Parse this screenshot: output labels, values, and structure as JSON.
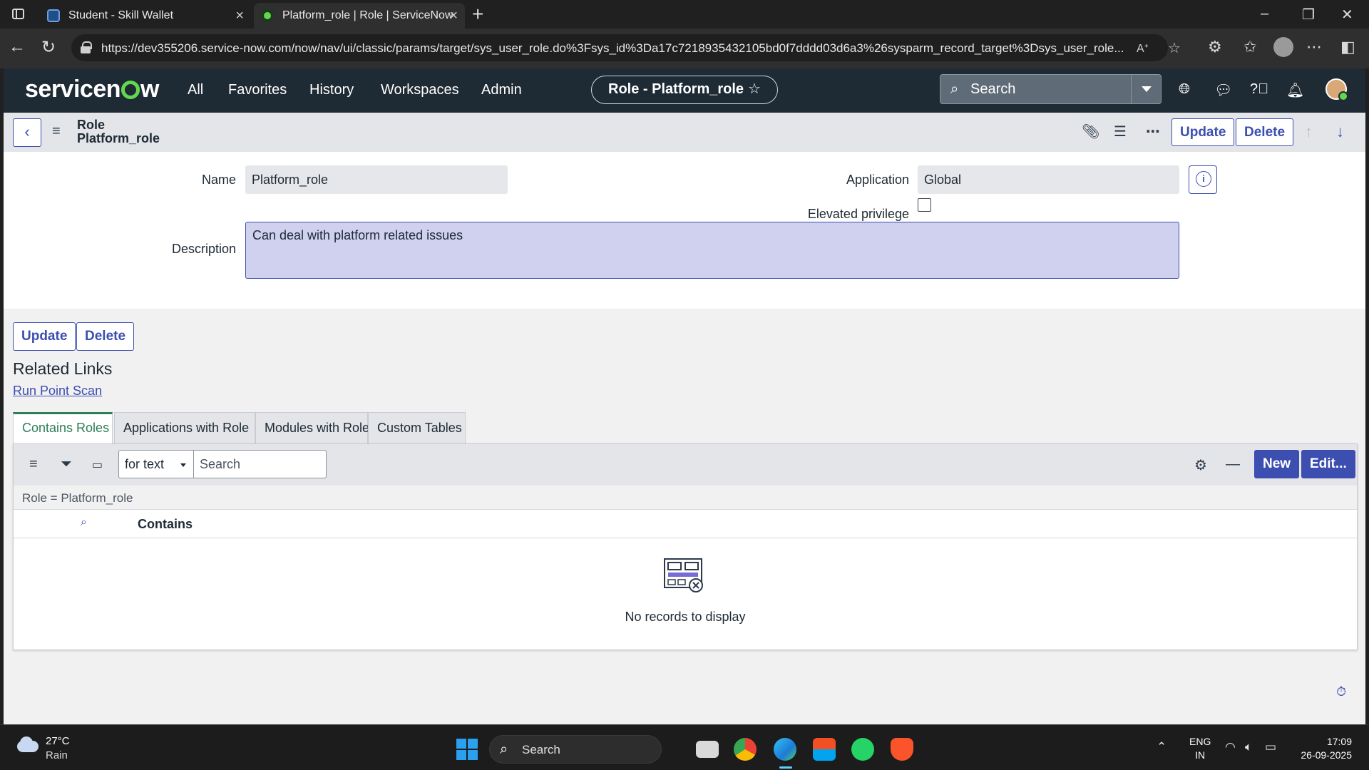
{
  "browser": {
    "tabs": [
      {
        "title": "Student - Skill Wallet"
      },
      {
        "title": "Platform_role | Role | ServiceNow"
      }
    ],
    "url": "https://dev355206.service-now.com/now/nav/ui/classic/params/target/sys_user_role.do%3Fsys_id%3Da17c7218935432105bd0f7dddd03d6a3%26sysparm_record_target%3Dsys_user_role..."
  },
  "header": {
    "nav": [
      "All",
      "Favorites",
      "History",
      "Workspaces",
      "Admin"
    ],
    "record_pill": "Role - Platform_role",
    "search_placeholder": "Search"
  },
  "form": {
    "title_line1": "Role",
    "title_line2": "Platform_role",
    "update_label": "Update",
    "delete_label": "Delete",
    "fields": {
      "name_label": "Name",
      "name_value": "Platform_role",
      "application_label": "Application",
      "application_value": "Global",
      "elevated_label": "Elevated privilege",
      "elevated_checked": false,
      "description_label": "Description",
      "description_value": "Can deal with platform related issues"
    }
  },
  "related": {
    "title": "Related Links",
    "link": "Run Point Scan",
    "tabs": [
      "Contains Roles",
      "Applications with Role",
      "Modules with Role",
      "Custom Tables"
    ],
    "active_tab": "Contains Roles"
  },
  "list": {
    "search_field": "for text",
    "search_placeholder": "Search",
    "new_label": "New",
    "edit_label": "Edit...",
    "breadcrumb": "Role = Platform_role",
    "column": "Contains",
    "empty_message": "No records to display"
  },
  "taskbar": {
    "temperature": "27°C",
    "condition": "Rain",
    "search_label": "Search",
    "lang_line1": "ENG",
    "lang_line2": "IN",
    "time": "17:09",
    "date": "26-09-2025"
  },
  "colors": {
    "accent": "#3c4eb0",
    "header_bg": "#1e2a34",
    "active_tab": "#2e7d5b",
    "brand_green": "#62d84e"
  }
}
